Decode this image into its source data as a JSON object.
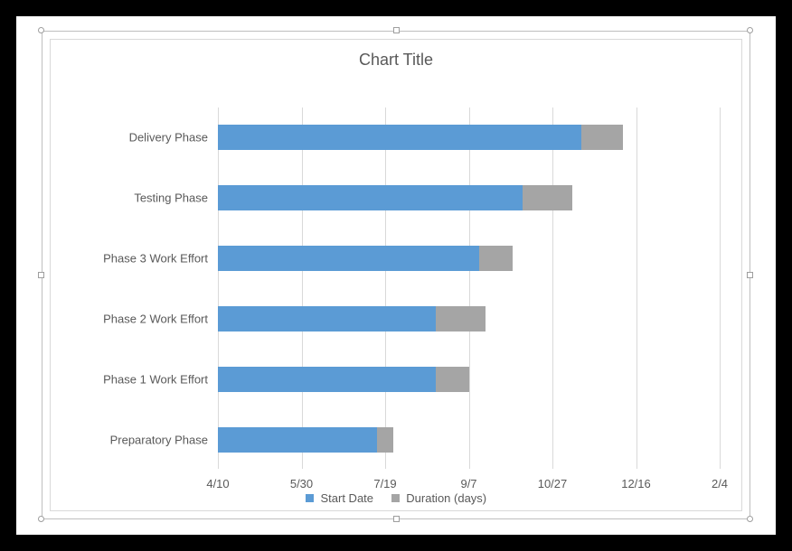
{
  "chart_data": {
    "type": "bar",
    "orientation": "horizontal_stacked",
    "title": "Chart Title",
    "categories": [
      "Delivery Phase",
      "Testing Phase",
      "Phase 3 Work Effort",
      "Phase 2 Work Effort",
      "Phase 1 Work Effort",
      "Preparatory Phase"
    ],
    "series": [
      {
        "name": "Start Date",
        "color": "#5b9bd5",
        "values_days_from_xmin": [
          217,
          182,
          156,
          130,
          130,
          95
        ]
      },
      {
        "name": "Duration (days)",
        "color": "#a5a5a5",
        "values_days_from_xmin": [
          25,
          30,
          20,
          30,
          20,
          10
        ]
      }
    ],
    "x_axis": {
      "ticks": [
        "4/10",
        "5/30",
        "7/19",
        "9/7",
        "10/27",
        "12/16",
        "2/4"
      ],
      "interval_days": 50,
      "min_label": "4/10",
      "max_label": "2/4",
      "range_days": 300
    },
    "legend_position": "bottom"
  },
  "title_text": "Chart Title",
  "legend": {
    "items": [
      {
        "label": "Start Date",
        "color": "#5b9bd5"
      },
      {
        "label": "Duration (days)",
        "color": "#a5a5a5"
      }
    ]
  },
  "x_ticks": [
    "4/10",
    "5/30",
    "7/19",
    "9/7",
    "10/27",
    "12/16",
    "2/4"
  ],
  "y_categories": [
    "Delivery Phase",
    "Testing Phase",
    "Phase 3 Work Effort",
    "Phase 2 Work Effort",
    "Phase 1 Work Effort",
    "Preparatory Phase"
  ]
}
